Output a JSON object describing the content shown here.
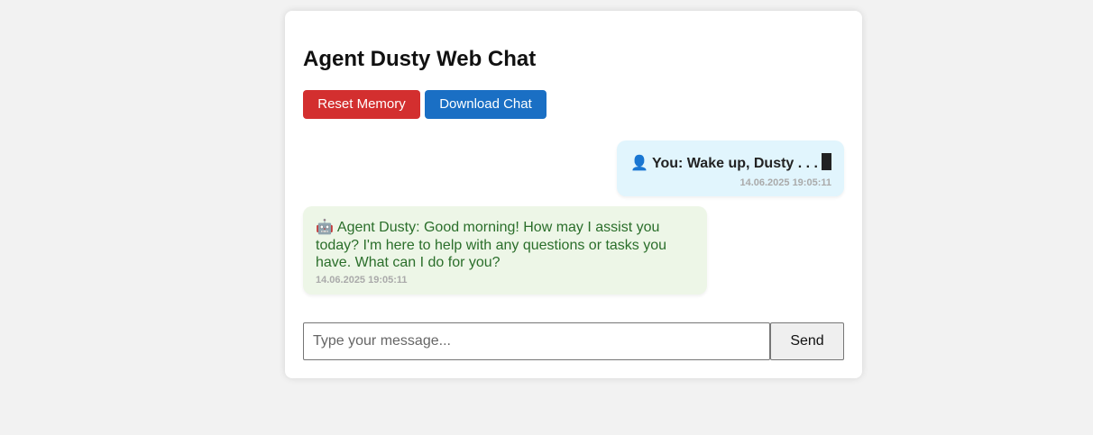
{
  "title": "Agent Dusty Web Chat",
  "buttons": {
    "reset_label": "Reset Memory",
    "download_label": "Download Chat",
    "reset_color": "#d32f2f",
    "download_color": "#1a6fc4"
  },
  "messages": [
    {
      "role": "user",
      "avatar": "👤",
      "avatar_icon": "user-silhouette-icon",
      "text": "You: Wake up, Dusty . . .",
      "timestamp": "14.06.2025 19:05:11",
      "bubble_color": "#e1f5fd"
    },
    {
      "role": "bot",
      "avatar": "🤖",
      "avatar_icon": "robot-icon",
      "text": "Agent Dusty: Good morning! How may I assist you today? I'm here to help with any questions or tasks you have. What can I do for you?",
      "timestamp": "14.06.2025 19:05:11",
      "bubble_color": "#edf6e7"
    }
  ],
  "composer": {
    "placeholder": "Type your message...",
    "value": "",
    "send_label": "Send"
  }
}
